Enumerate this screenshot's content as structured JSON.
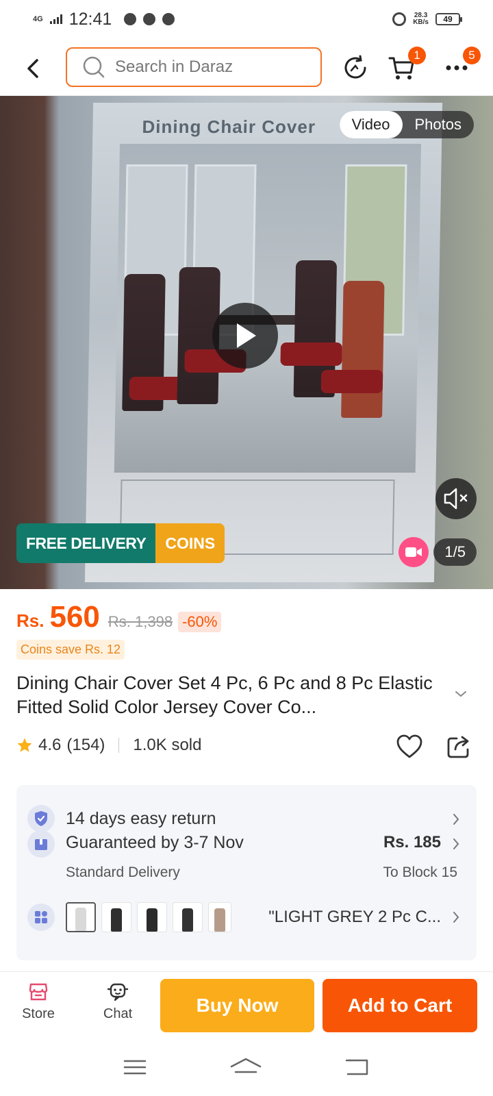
{
  "status_bar": {
    "network": "4G",
    "time": "12:41",
    "speed_value": "28.3",
    "speed_unit": "KB/s",
    "battery": "49"
  },
  "header": {
    "search_placeholder": "Search in Daraz",
    "cart_badge": "1",
    "more_badge": "5"
  },
  "media": {
    "tab_video": "Video",
    "tab_photos": "Photos",
    "box_title": "Dining Chair Cover",
    "promo_free_delivery": "FREE DELIVERY",
    "promo_coins": "COINS",
    "counter": "1/5"
  },
  "price": {
    "currency": "Rs.",
    "amount": "560",
    "original": "Rs. 1,398",
    "discount": "-60%",
    "coins_save": "Coins save Rs. 12"
  },
  "product": {
    "title": "Dining Chair Cover Set 4 Pc, 6 Pc and 8 Pc Elastic Fitted Solid Color Jersey Cover Co...",
    "rating": "4.6",
    "reviews": "(154)",
    "sold": "1.0K sold"
  },
  "info": {
    "return_text": "14 days easy return",
    "delivery_text": "Guaranteed by 3-7 Nov",
    "delivery_sub": "Standard Delivery",
    "delivery_price": "Rs. 185",
    "delivery_location": "To Block 15",
    "variant_text": "\"LIGHT GREY 2 Pc C...",
    "variant_colors": [
      "#d9d9d9",
      "#2f2f2f",
      "#2b2b2b",
      "#333333",
      "#b59c8a"
    ]
  },
  "bottom_bar": {
    "store": "Store",
    "chat": "Chat",
    "buy_now": "Buy Now",
    "add_to_cart": "Add to Cart"
  },
  "colors": {
    "brand_orange": "#f85606",
    "buy_yellow": "#fbac1a",
    "free_delivery_green": "#127a6a",
    "coins_yellow": "#f0a41a"
  }
}
